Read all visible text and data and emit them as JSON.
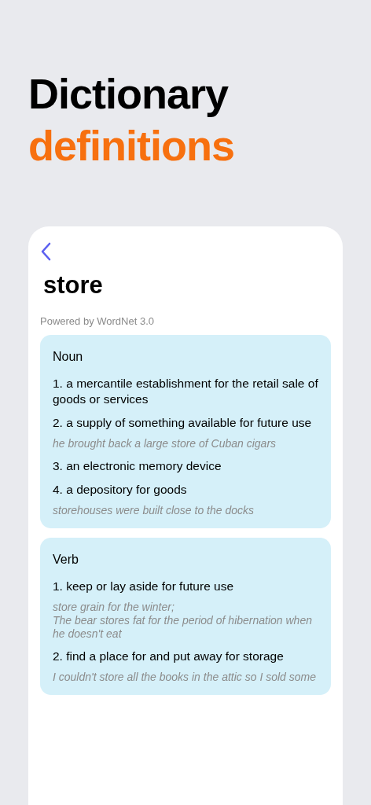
{
  "headline": {
    "line_1": "Dictionary",
    "line_2": "definitions"
  },
  "word": "store",
  "attribution": "Powered by WordNet 3.0",
  "sections": [
    {
      "part_of_speech": "Noun",
      "senses": [
        {
          "definition": "1. a mercantile establishment for the retail sale of goods or services"
        },
        {
          "definition": "2. a supply of something available for future use",
          "example": "he brought back a large store of Cuban cigars"
        },
        {
          "definition": "3. an electronic memory device"
        },
        {
          "definition": "4. a depository for goods",
          "example": "storehouses were built close to the docks"
        }
      ]
    },
    {
      "part_of_speech": "Verb",
      "senses": [
        {
          "definition": "1. keep or lay aside for future use",
          "example": "store grain for the winter;\nThe bear stores fat for the period of hibernation when he doesn't eat"
        },
        {
          "definition": "2. find a place for and put away for storage",
          "example": "I couldn't store all the books in the attic so I sold some"
        }
      ]
    }
  ]
}
